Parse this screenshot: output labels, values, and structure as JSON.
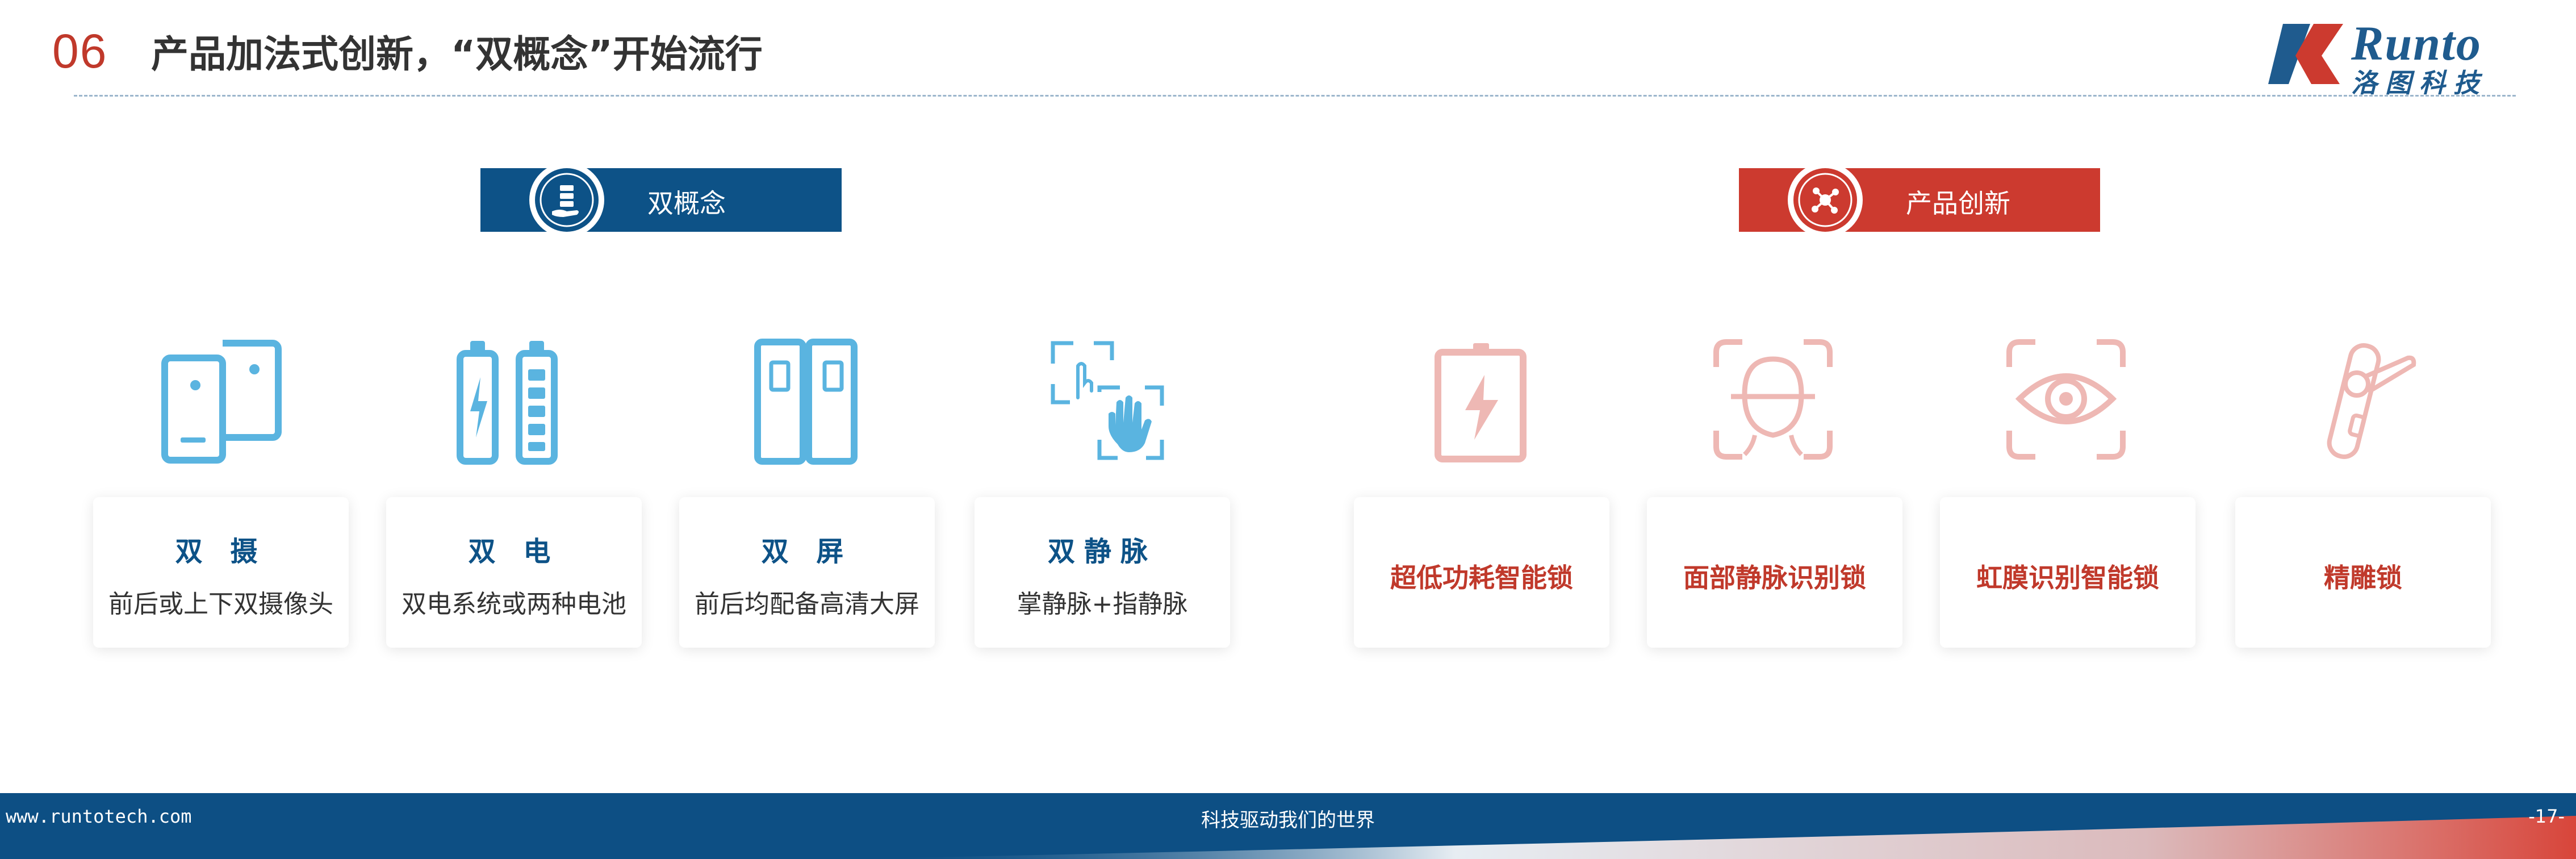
{
  "header": {
    "section_number": "06",
    "title": "产品加法式创新，“双概念”开始流行"
  },
  "logo": {
    "wordmark": "Runto",
    "cn_name": "洛图科技"
  },
  "banners": {
    "left_label": "双概念",
    "right_label": "产品创新"
  },
  "dual_cards": [
    {
      "title": "双 摄",
      "desc": "前后或上下双摄像头",
      "icon": "dual-phone-icon"
    },
    {
      "title": "双 电",
      "desc": "双电系统或两种电池",
      "icon": "dual-battery-icon"
    },
    {
      "title": "双 屏",
      "desc": "前后均配备高清大屏",
      "icon": "dual-screen-icon"
    },
    {
      "title": "双静脉",
      "desc": "掌静脉+指静脉",
      "icon": "palm-vein-icon"
    }
  ],
  "innovation_cards": [
    {
      "title": "超低功耗智能锁",
      "icon": "low-power-icon"
    },
    {
      "title": "面部静脉识别锁",
      "icon": "face-scan-icon"
    },
    {
      "title": "虹膜识别智能锁",
      "icon": "iris-scan-icon"
    },
    {
      "title": "精雕锁",
      "icon": "door-handle-icon"
    }
  ],
  "colors": {
    "brand_blue": "#0d5287",
    "brand_red": "#cc3a2f",
    "icon_blue": "#5ab4e0",
    "icon_pink": "#eeb8b4"
  },
  "footer": {
    "url": "www.runtotech.com",
    "slogan": "科技驱动我们的世界",
    "page": "-17-"
  }
}
